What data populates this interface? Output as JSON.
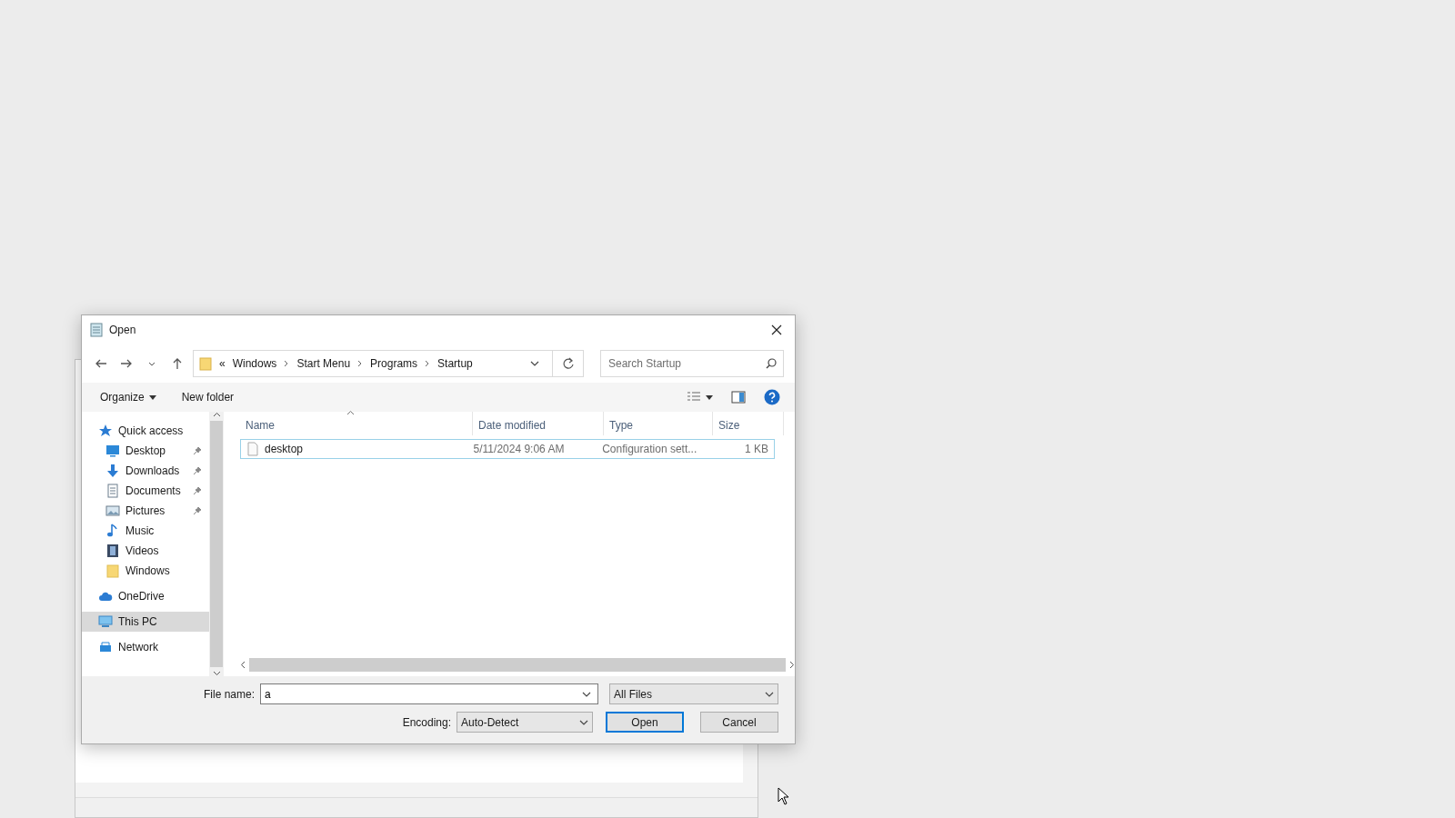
{
  "window": {
    "title": "Open"
  },
  "address_bar": {
    "overflow": "«",
    "path": [
      "Windows",
      "Start Menu",
      "Programs",
      "Startup"
    ]
  },
  "search": {
    "placeholder": "Search Startup"
  },
  "toolbar": {
    "organize": "Organize",
    "new_folder": "New folder"
  },
  "nav": [
    {
      "label": "Quick access",
      "kind": "star",
      "selected": false,
      "children": [
        {
          "label": "Desktop",
          "kind": "desktop",
          "pinned": true,
          "selected": false
        },
        {
          "label": "Downloads",
          "kind": "download",
          "pinned": true,
          "selected": false
        },
        {
          "label": "Documents",
          "kind": "document",
          "pinned": true,
          "selected": false
        },
        {
          "label": "Pictures",
          "kind": "pictures",
          "pinned": true,
          "selected": false
        },
        {
          "label": "Music",
          "kind": "music",
          "pinned": false,
          "selected": false
        },
        {
          "label": "Videos",
          "kind": "videos",
          "pinned": false,
          "selected": false
        },
        {
          "label": "Windows",
          "kind": "folder",
          "pinned": false,
          "selected": false
        }
      ]
    },
    {
      "label": "OneDrive",
      "kind": "cloud",
      "selected": false
    },
    {
      "label": "This PC",
      "kind": "pc",
      "selected": true
    },
    {
      "label": "Network",
      "kind": "network",
      "selected": false
    }
  ],
  "table": {
    "columns": [
      {
        "label": "Name",
        "sorted": true
      },
      {
        "label": "Date modified",
        "sorted": false
      },
      {
        "label": "Type",
        "sorted": false
      },
      {
        "label": "Size",
        "sorted": false
      }
    ],
    "rows": [
      {
        "name": "desktop",
        "date_modified": "5/11/2024 9:06 AM",
        "type": "Configuration sett...",
        "size": "1 KB",
        "focused": true
      }
    ]
  },
  "file_name": {
    "label": "File name:",
    "value": "a"
  },
  "file_type": "All Files",
  "encoding": {
    "label": "Encoding:",
    "value": "Auto-Detect"
  },
  "buttons": [
    {
      "label": "Open",
      "default": true
    },
    {
      "label": "Cancel",
      "default": false
    }
  ]
}
